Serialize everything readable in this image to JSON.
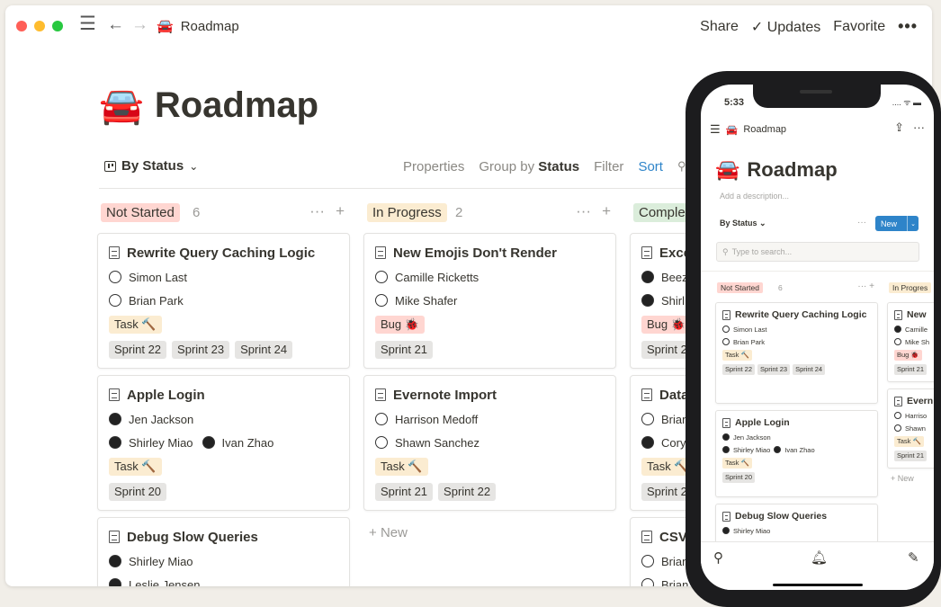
{
  "app": {
    "title": "Roadmap",
    "emoji": "🚘",
    "topbar": {
      "share": "Share",
      "updates": "Updates",
      "favorite": "Favorite",
      "more": "•••"
    }
  },
  "page": {
    "title": "Roadmap",
    "emoji": "🚘"
  },
  "view": {
    "name": "By Status",
    "options": {
      "properties": "Properties",
      "group_by": "Group by",
      "group_by_value": "Status",
      "filter": "Filter",
      "sort": "Sort"
    }
  },
  "columns": [
    {
      "name": "Not Started",
      "count": "6",
      "color": "#ffd6d1",
      "cards": [
        {
          "title": "Rewrite Query Caching Logic",
          "people": [
            [
              "Simon Last"
            ],
            [
              "Brian Park"
            ]
          ],
          "type": "Task 🔨",
          "sprints": [
            "Sprint 22",
            "Sprint 23",
            "Sprint 24"
          ]
        },
        {
          "title": "Apple Login",
          "people": [
            [
              "Jen Jackson"
            ],
            [
              "Shirley Miao",
              "Ivan Zhao"
            ]
          ],
          "type": "Task 🔨",
          "sprints": [
            "Sprint 20"
          ]
        },
        {
          "title": "Debug Slow Queries",
          "people": [
            [
              "Shirley Miao"
            ],
            [
              "Leslie Jensen"
            ]
          ]
        }
      ]
    },
    {
      "name": "In Progress",
      "count": "2",
      "color": "#fbecd1",
      "cards": [
        {
          "title": "New Emojis Don't Render",
          "people": [
            [
              "Camille Ricketts"
            ],
            [
              "Mike Shafer"
            ]
          ],
          "type": "Bug 🐞",
          "sprints": [
            "Sprint 21"
          ]
        },
        {
          "title": "Evernote Import",
          "people": [
            [
              "Harrison Medoff"
            ],
            [
              "Shawn Sanchez"
            ]
          ],
          "type": "Task 🔨",
          "sprints": [
            "Sprint 21",
            "Sprint 22"
          ]
        }
      ],
      "new_label": "New"
    },
    {
      "name": "Comple",
      "color": "#dbeddb",
      "cards": [
        {
          "title": "Exce",
          "people": [
            [
              "Beez"
            ],
            [
              "Shirl"
            ]
          ],
          "type": "Bug 🐞",
          "sprints": [
            "Sprint 2"
          ]
        },
        {
          "title": "Data",
          "people": [
            [
              "Brian"
            ],
            [
              "Cory"
            ]
          ],
          "type": "Task 🔨",
          "sprints": [
            "Sprint 2"
          ]
        },
        {
          "title": "CSV",
          "people": [
            [
              "Brian"
            ],
            [
              "Brian"
            ]
          ]
        }
      ]
    }
  ],
  "phone": {
    "time": "5:33",
    "status": ".... ᯤ ▬",
    "nav_title": "Roadmap",
    "title": "Roadmap",
    "description": "Add a description...",
    "view_name": "By Status ⌄",
    "more": "···",
    "new_button": "New",
    "search_placeholder": "Type to search...",
    "col1": {
      "name": "Not Started",
      "count": "6"
    },
    "col2": {
      "name": "In Progres"
    },
    "cards1": [
      {
        "title": "Rewrite Query Caching Logic",
        "people": [
          "Simon Last",
          "Brian Park"
        ],
        "type": "Task 🔨",
        "sprints": [
          "Sprint 22",
          "Sprint 23",
          "Sprint 24"
        ]
      },
      {
        "title": "Apple Login",
        "people": [
          "Jen Jackson",
          "Shirley Miao",
          "Ivan Zhao"
        ],
        "type": "Task 🔨",
        "sprints": [
          "Sprint 20"
        ]
      },
      {
        "title": "Debug Slow Queries",
        "people": [
          "Shirley Miao"
        ]
      }
    ],
    "cards2": [
      {
        "title": "New",
        "people": [
          "Camille",
          "Mike Sh"
        ],
        "type": "Bug 🐞",
        "sprints": [
          "Sprint 21"
        ]
      },
      {
        "title": "Evern",
        "people": [
          "Harriso",
          "Shawn"
        ],
        "type": "Task 🔨",
        "sprints": [
          "Sprint 21"
        ]
      }
    ],
    "new_label": "+ New"
  }
}
